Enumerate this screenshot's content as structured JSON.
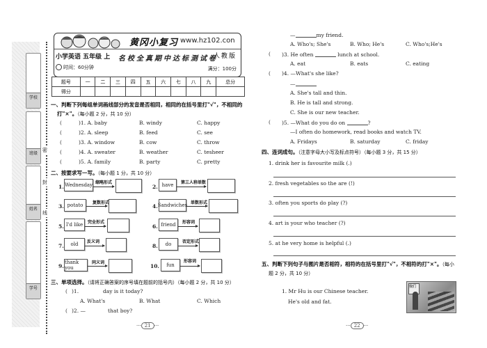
{
  "binding_strip": {
    "labels": [
      "学校",
      "班级",
      "姓名",
      "学号"
    ],
    "cut_marks": [
      "密",
      "封",
      "线"
    ]
  },
  "header": {
    "brand": "黄冈小复习",
    "url": "www.hz102.con",
    "subject": "小学英语  五年级 上",
    "exam_title": "名校全真期中达标测试卷",
    "edition": "人教版",
    "time": "时间：60分钟",
    "full_score": "满分：100分"
  },
  "score_table": {
    "header": [
      "题号",
      "一",
      "二",
      "三",
      "四",
      "五",
      "六",
      "七",
      "八",
      "九",
      "总分"
    ],
    "row_label": "得分"
  },
  "section1": {
    "title": "一、判断下列每组单词画线部分的发音是否相同，相同的在括号里打\"√\"，不相同的",
    "title_cont": "打\"×\"。",
    "note": "（每小题 2 分，共 10 分）",
    "items": [
      {
        "n": ")1.",
        "a": "A. baby",
        "b": "B. windy",
        "c": "C. happy"
      },
      {
        "n": ")2.",
        "a": "A. sleep",
        "b": "B. feed",
        "c": "C. see"
      },
      {
        "n": ")3.",
        "a": "A. window",
        "b": "B. cow",
        "c": "C. throw"
      },
      {
        "n": ")4.",
        "a": "A. sweater",
        "b": "B. weather",
        "c": "C. tesheer"
      },
      {
        "n": ")5.",
        "a": "A. family",
        "b": "B. party",
        "c": "C. pretty"
      }
    ]
  },
  "section2": {
    "title": "二、按要求写一写。",
    "note": "（每小题 1 分，共 10 分）",
    "items": [
      {
        "n": "1.",
        "word": "Wednesday",
        "rule": "缩略形式"
      },
      {
        "n": "2.",
        "word": "have",
        "rule": "第三人称单数"
      },
      {
        "n": "3.",
        "word": "potato",
        "rule": "复数形式"
      },
      {
        "n": "4.",
        "word": "Sandwiches",
        "rule": "单数形式"
      },
      {
        "n": "5.",
        "word": "I'd like",
        "rule": "完全形式"
      },
      {
        "n": "6.",
        "word": "friend",
        "rule": "形容词"
      },
      {
        "n": "7.",
        "word": "old",
        "rule": "反义词"
      },
      {
        "n": "8.",
        "word": "do",
        "rule": "否定形式"
      },
      {
        "n": "9.",
        "word": "thank you",
        "rule": "同义词"
      },
      {
        "n": "10.",
        "word": "fun",
        "rule": "形容词"
      }
    ]
  },
  "section3": {
    "title": "三、单项选择。",
    "note": "（请将正确答案的序号填在题前的括号内）（每小题 2 分，共 10 分）",
    "q11": {
      "n": ")1.",
      "text": "day is it today?",
      "a": "A. What's",
      "b": "B. What",
      "c": "C. Which"
    },
    "q12": {
      "n": ")2. —",
      "text": "that boy?",
      "line2": "my friend.",
      "a": "A. Who's; She's",
      "b": "B. Who; He's",
      "c": "C. Who's;He's"
    },
    "q13": {
      "n": ")3.",
      "text_before": "He often",
      "text_after": "lunch at school.",
      "a": "A. eat",
      "b": "B. eats",
      "c": "C. eating"
    },
    "q14": {
      "n": ")4.",
      "text": "—What's she like?",
      "a": "A. She's tall and thin.",
      "b": "B. He is tall and strong.",
      "c": "C. She is our new teacher."
    },
    "q15": {
      "n": ")5.",
      "text": "—What do you do on",
      "text_end": "?",
      "line2": "—I often do homework, read books and watch TV.",
      "a": "A. Fridays",
      "b": "B. saturday",
      "c": "C. friday"
    }
  },
  "section4": {
    "title": "四、连词成句。",
    "note": "（注意字母大小写及标点符号）（每小题 3 分，共 15 分）",
    "items": [
      "1. drink  her  is  favourite  milk  (.)",
      "2. fresh  vegetables  so  the  are  (!)",
      "3. often  you  sports  do  play  (?)",
      "4. art  is  your  who  teacher  (?)",
      "5. at  he  very  home  is  helpful  (.)"
    ]
  },
  "section5": {
    "title": "五、判断下列句子与图片是否相符，相符的在括号里打\"√\"，不相符的打\"×\"。",
    "note_a": "（每小",
    "note_b": "题 2 分，共 10 分）",
    "item1_line1": "1. Mr Hu is our Chinese teacher.",
    "item1_line2": "He's old and fat.",
    "picture_board_text": "我们"
  },
  "page_numbers": {
    "left": "21",
    "right": "22"
  },
  "paren_open": "("
}
